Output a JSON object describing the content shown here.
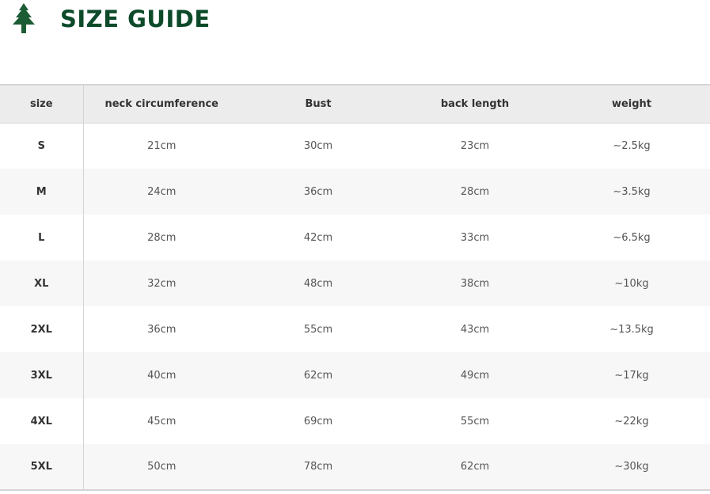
{
  "header": {
    "title": "SIZE GUIDE",
    "icon": "pine-tree-icon",
    "brand_color": "#0d4a2a",
    "icon_color": "#1c5c34"
  },
  "table": {
    "columns": [
      "size",
      "neck circumference",
      "Bust",
      "back length",
      "weight"
    ],
    "rows": [
      {
        "size": "S",
        "neck": "21cm",
        "bust": "30cm",
        "back": "23cm",
        "weight": "~2.5kg"
      },
      {
        "size": "M",
        "neck": "24cm",
        "bust": "36cm",
        "back": "28cm",
        "weight": "~3.5kg"
      },
      {
        "size": "L",
        "neck": "28cm",
        "bust": "42cm",
        "back": "33cm",
        "weight": "~6.5kg"
      },
      {
        "size": "XL",
        "neck": "32cm",
        "bust": "48cm",
        "back": "38cm",
        "weight": "~10kg"
      },
      {
        "size": "2XL",
        "neck": "36cm",
        "bust": "55cm",
        "back": "43cm",
        "weight": "~13.5kg"
      },
      {
        "size": "3XL",
        "neck": "40cm",
        "bust": "62cm",
        "back": "49cm",
        "weight": "~17kg"
      },
      {
        "size": "4XL",
        "neck": "45cm",
        "bust": "69cm",
        "back": "55cm",
        "weight": "~22kg"
      },
      {
        "size": "5XL",
        "neck": "50cm",
        "bust": "78cm",
        "back": "62cm",
        "weight": "~30kg"
      }
    ]
  }
}
